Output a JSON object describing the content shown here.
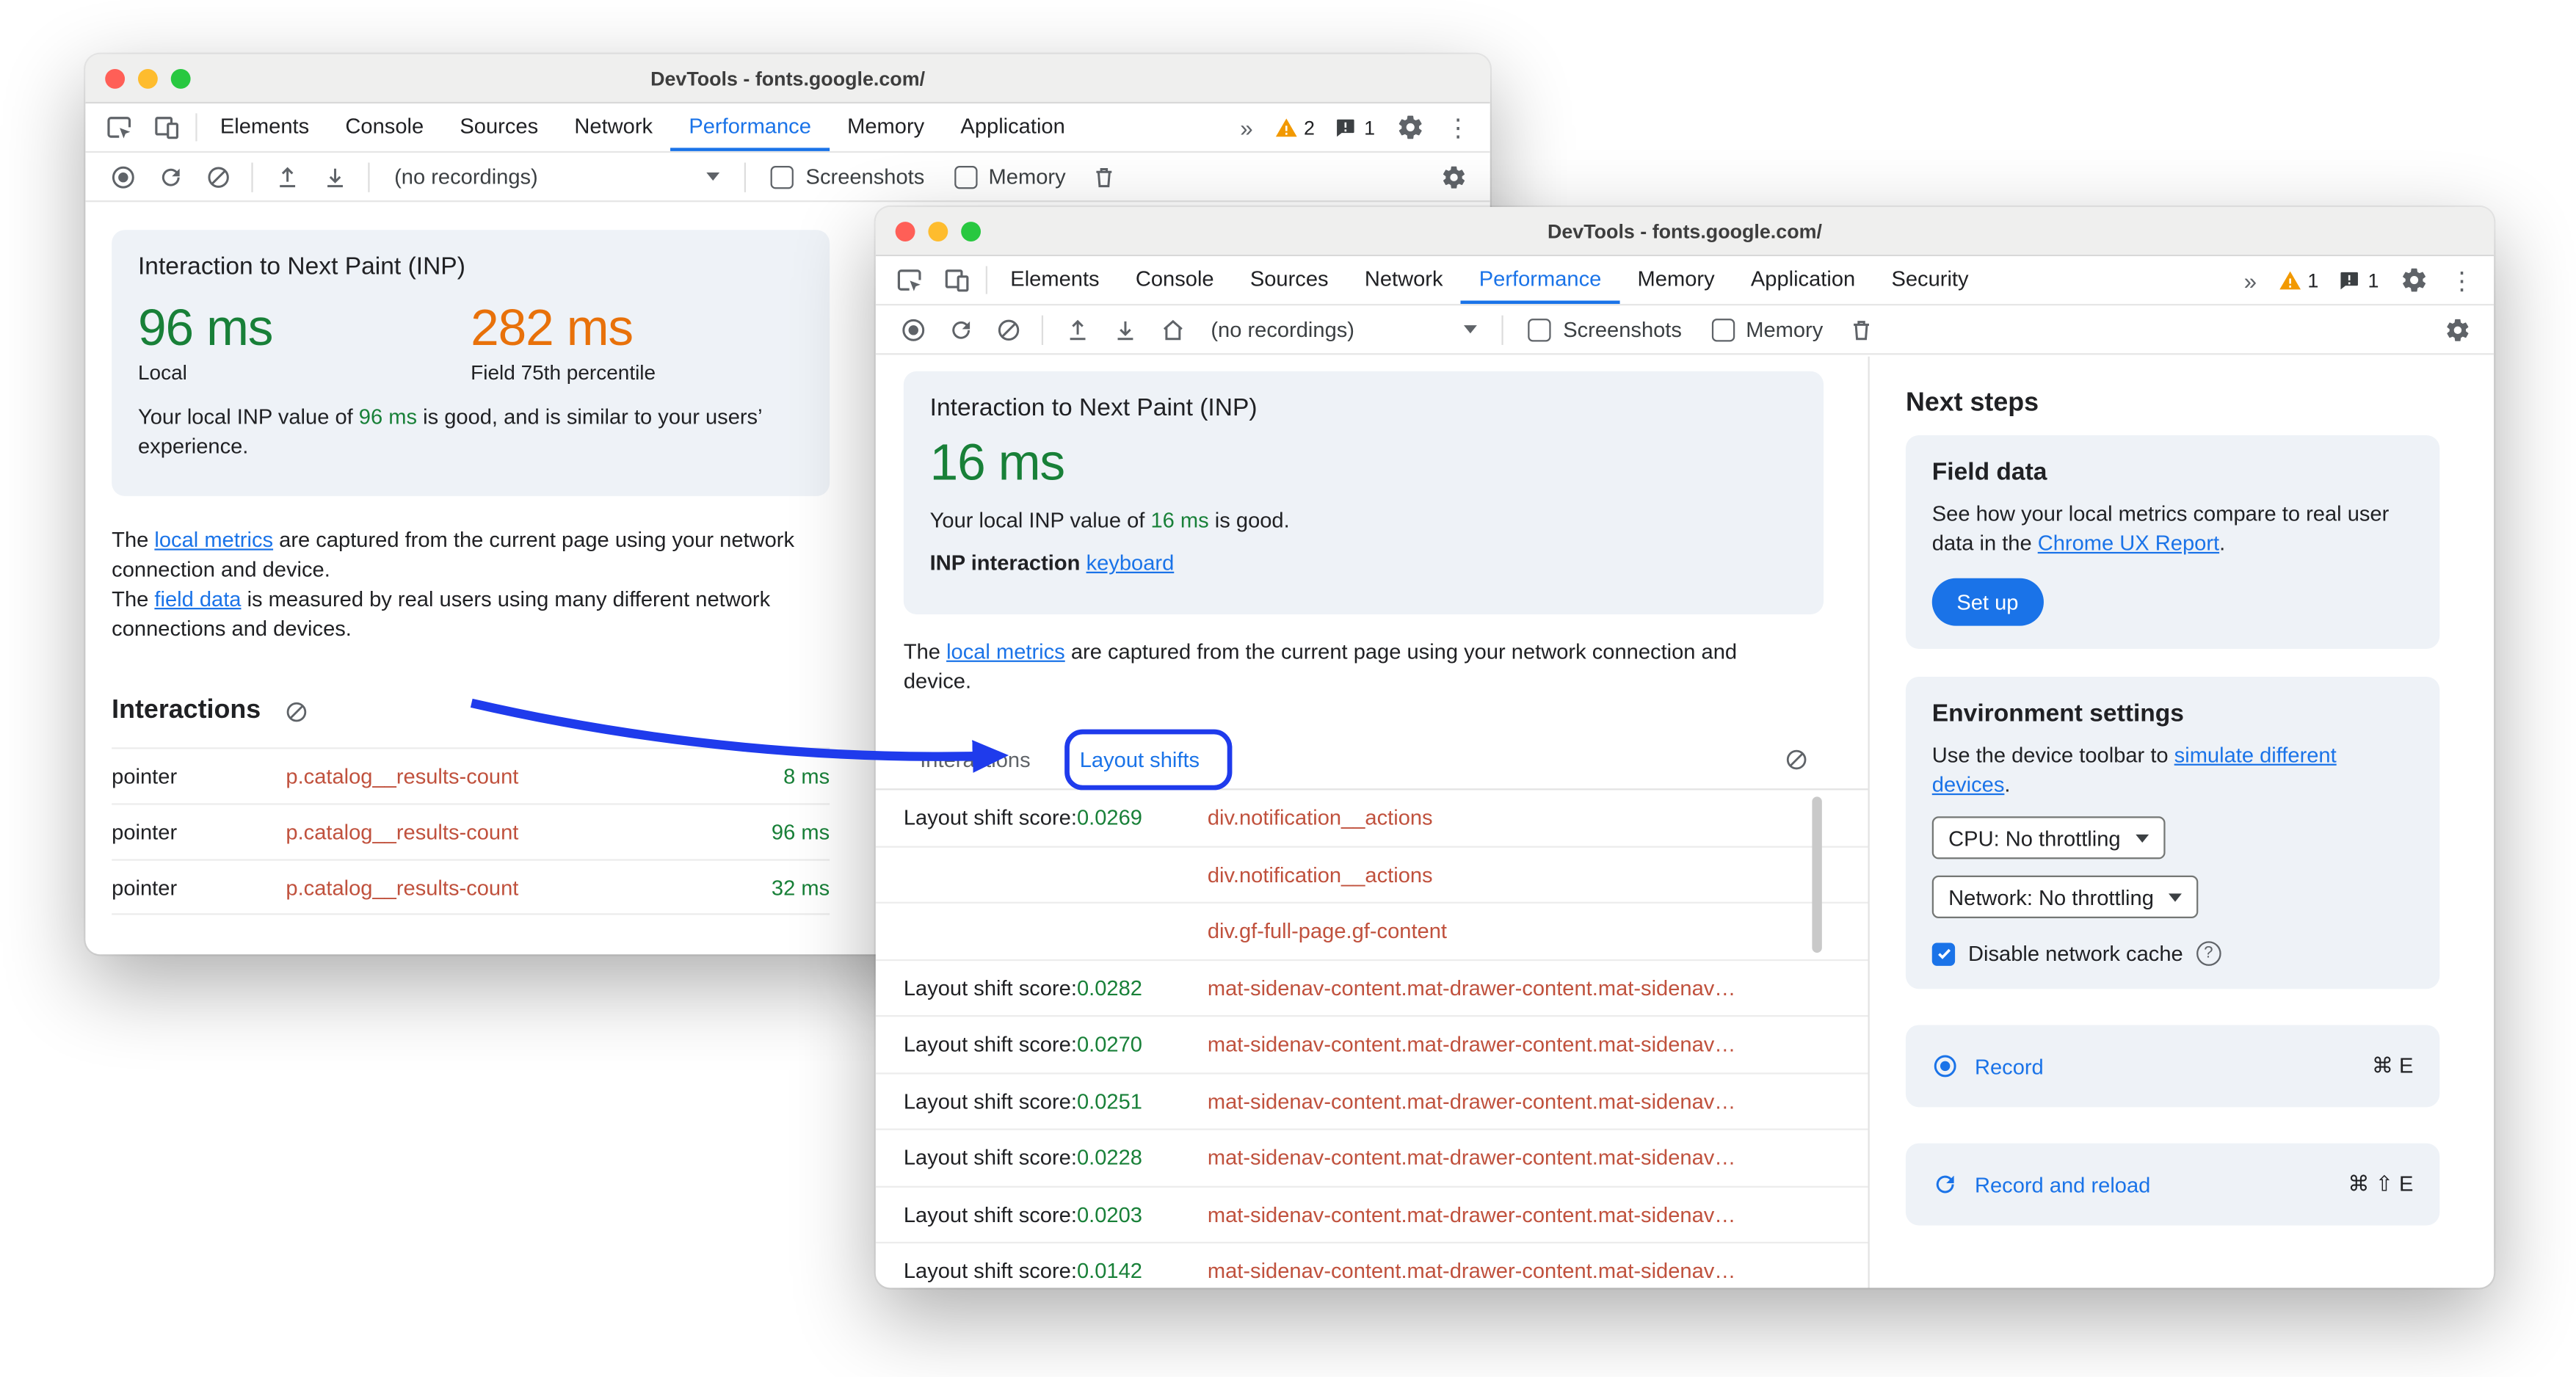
{
  "colors": {
    "accent_blue": "#1a73e8",
    "good_green": "#188038",
    "field_orange": "#e8710a",
    "node_red": "#c0513d",
    "annotation_blue": "#1f3bec"
  },
  "window_back": {
    "title": "DevTools - fonts.google.com/",
    "tabs": [
      "Elements",
      "Console",
      "Sources",
      "Network",
      "Performance",
      "Memory",
      "Application"
    ],
    "more_tabs_icon": "»",
    "warning_count": "2",
    "issue_count": "1",
    "kebab_icon": "⋮",
    "toolbar": {
      "recordings_select": "(no recordings)",
      "screenshots_label": "Screenshots",
      "memory_label": "Memory"
    },
    "inp_card": {
      "title": "Interaction to Next Paint (INP)",
      "local_value": "96 ms",
      "local_label": "Local",
      "field_value": "282 ms",
      "field_label": "Field 75th percentile",
      "summary_pre": "Your local INP value of ",
      "summary_value": "96 ms",
      "summary_post": " is good, and is similar to your users’ experience."
    },
    "info_p1_pre": "The ",
    "info_p1_link": "local metrics",
    "info_p1_post": " are captured from the current page using your network connection and device.",
    "info_p2_pre": "The ",
    "info_p2_link": "field data",
    "info_p2_post": " is measured by real users using many different network connections and devices.",
    "interactions_heading": "Interactions",
    "interaction_rows": [
      {
        "type": "pointer",
        "node": "p.catalog__results-count",
        "duration": "8 ms"
      },
      {
        "type": "pointer",
        "node": "p.catalog__results-count",
        "duration": "96 ms"
      },
      {
        "type": "pointer",
        "node": "p.catalog__results-count",
        "duration": "32 ms"
      }
    ]
  },
  "window_front": {
    "title": "DevTools - fonts.google.com/",
    "tabs": [
      "Elements",
      "Console",
      "Sources",
      "Network",
      "Performance",
      "Memory",
      "Application",
      "Security"
    ],
    "more_tabs_icon": "»",
    "warning_count": "1",
    "issue_count": "1",
    "kebab_icon": "⋮",
    "toolbar": {
      "recordings_select": "(no recordings)",
      "screenshots_label": "Screenshots",
      "memory_label": "Memory"
    },
    "inp_card": {
      "title": "Interaction to Next Paint (INP)",
      "value": "16 ms",
      "summary_pre": "Your local INP value of ",
      "summary_value": "16 ms",
      "summary_post": " is good.",
      "interaction_label": "INP interaction",
      "interaction_link": "keyboard"
    },
    "info_p1_pre": "The ",
    "info_p1_link": "local metrics",
    "info_p1_post": " are captured from the current page using your network connection and device.",
    "subtab_interactions": "Interactions",
    "subtab_layout_shifts": "Layout shifts",
    "shift_rows": [
      {
        "label": "Layout shift score: ",
        "score": "0.0269",
        "node": "div.notification__actions"
      },
      {
        "label": "",
        "score": "",
        "node": "div.notification__actions"
      },
      {
        "label": "",
        "score": "",
        "node": "div.gf-full-page.gf-content"
      },
      {
        "label": "Layout shift score: ",
        "score": "0.0282",
        "node": "mat-sidenav-content.mat-drawer-content.mat-sidenav…"
      },
      {
        "label": "Layout shift score: ",
        "score": "0.0270",
        "node": "mat-sidenav-content.mat-drawer-content.mat-sidenav…"
      },
      {
        "label": "Layout shift score: ",
        "score": "0.0251",
        "node": "mat-sidenav-content.mat-drawer-content.mat-sidenav…"
      },
      {
        "label": "Layout shift score: ",
        "score": "0.0228",
        "node": "mat-sidenav-content.mat-drawer-content.mat-sidenav…"
      },
      {
        "label": "Layout shift score: ",
        "score": "0.0203",
        "node": "mat-sidenav-content.mat-drawer-content.mat-sidenav…"
      },
      {
        "label": "Layout shift score: ",
        "score": "0.0142",
        "node": "mat-sidenav-content.mat-drawer-content.mat-sidenav…"
      }
    ],
    "sidebar": {
      "heading": "Next steps",
      "field_data_title": "Field data",
      "field_data_pre": "See how your local metrics compare to real user data in the ",
      "field_data_link": "Chrome UX Report",
      "field_data_post": ".",
      "setup_button": "Set up",
      "env_title": "Environment settings",
      "env_pre": "Use the device toolbar to ",
      "env_link": "simulate different devices",
      "env_post": ".",
      "cpu_select": "CPU: No throttling",
      "network_select": "Network: No throttling",
      "cache_label": "Disable network cache",
      "record_label": "Record",
      "record_shortcut": "⌘ E",
      "record_reload_label": "Record and reload",
      "record_reload_shortcut": "⌘ ⇧ E"
    }
  }
}
